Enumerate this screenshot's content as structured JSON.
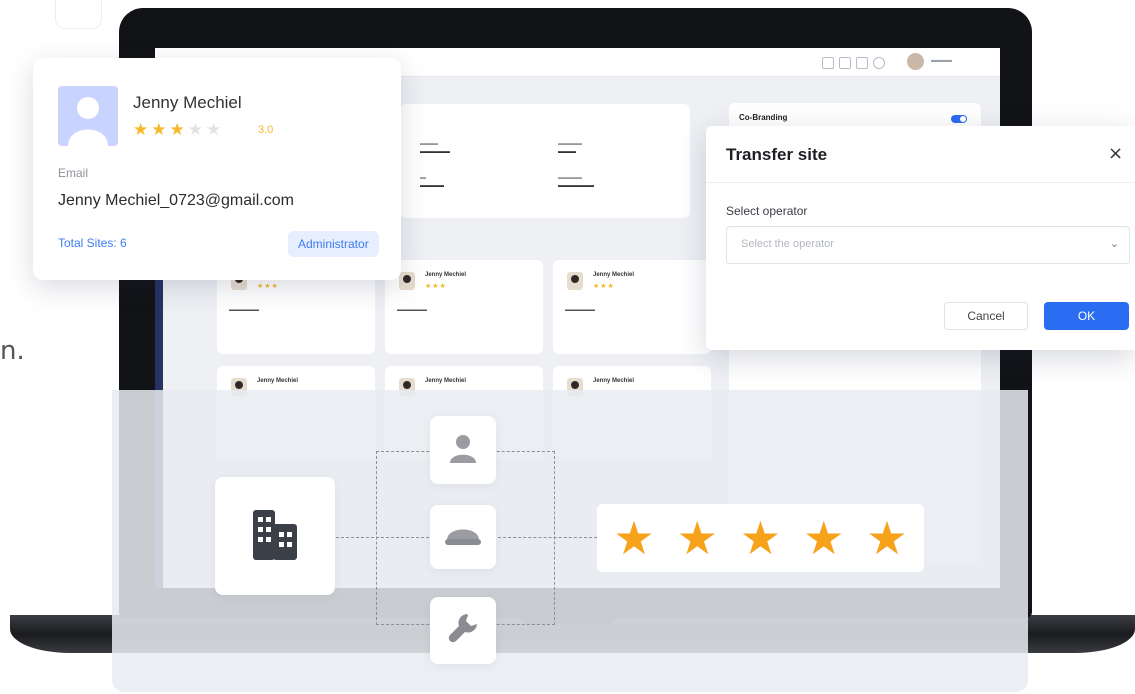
{
  "profile_card": {
    "name": "Jenny Mechiel",
    "rating": 3,
    "rating_max": 5,
    "rating_text": "3.0",
    "email_label": "Email",
    "email": "Jenny Mechiel_0723@gmail.com",
    "total_sites": "Total Sites: 6",
    "role": "Administrator"
  },
  "dashboard": {
    "co_branding_title": "Co-Branding",
    "user_cards": [
      {
        "name": "Jenny Mechiel"
      },
      {
        "name": "Jenny Mechiel"
      },
      {
        "name": "Jenny Mechiel"
      },
      {
        "name": "Jenny Mechiel"
      },
      {
        "name": "Jenny Mechiel"
      }
    ]
  },
  "transfer_modal": {
    "title": "Transfer site",
    "close_glyph": "×",
    "select_label": "Select operator",
    "select_placeholder": "Select the operator",
    "cancel_label": "Cancel",
    "ok_label": "OK"
  },
  "rating_banner": {
    "stars": 5
  },
  "edge_glyph": "n.",
  "colors": {
    "accent": "#2b6df2",
    "star": "#f7a21b",
    "sidebar": "#253262",
    "avatar_bg": "#c8d4ff"
  },
  "icons": [
    "building-icon",
    "user-icon",
    "helmet-icon",
    "wrench-icon",
    "star-icon",
    "close-icon",
    "chevron-down-icon"
  ]
}
